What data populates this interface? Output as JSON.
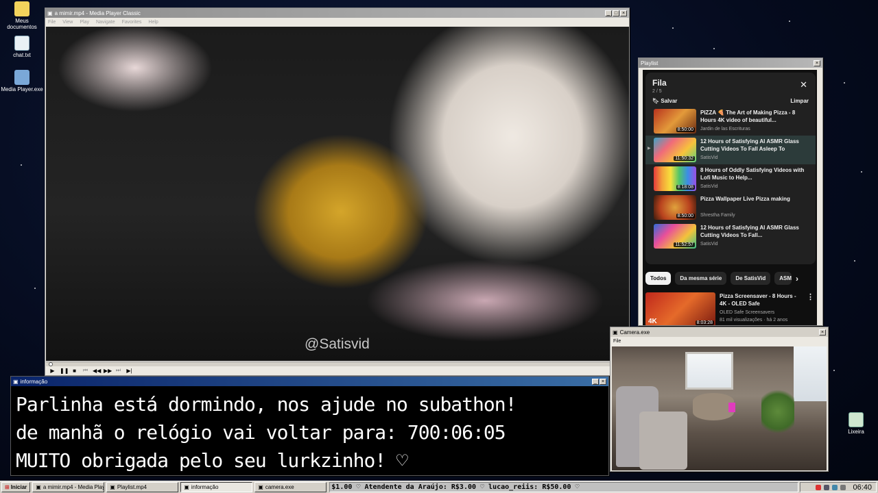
{
  "desktop": {
    "icons": [
      {
        "label": "Meus documentos"
      },
      {
        "label": "chat.txt"
      },
      {
        "label": "Media Player.exe"
      },
      {
        "label": "Lixeira"
      }
    ]
  },
  "player": {
    "title": "a mimir.mp4 - Media Player Classic",
    "menu": [
      "File",
      "View",
      "Play",
      "Navigate",
      "Favorites",
      "Help"
    ],
    "watermark": "@Satisvid"
  },
  "info": {
    "title": "informação",
    "lines": [
      "Parlinha está dormindo, nos ajude no subathon!",
      "de manhã o relógio vai voltar para:  700:06:05",
      "MUITO obrigada pelo seu lurkzinho! ♡"
    ]
  },
  "playlist": {
    "title": "Playlist",
    "queue_title": "Fila",
    "queue_count": "2 / 5",
    "save_label": "Salvar",
    "clear_label": "Limpar",
    "items": [
      {
        "title": "PIZZA 🍕 The Art of Making Pizza - 8 Hours 4K video of beautiful...",
        "channel": "Jardin de las Escrituras",
        "duration": "8:50:00"
      },
      {
        "title": "12 Hours of Satisfying AI ASMR Glass Cutting Videos To Fall Asleep To",
        "channel": "SatisVid",
        "duration": "11:50:32"
      },
      {
        "title": "8 Hours of Oddly Satisfying Videos with Lofi Music to Help...",
        "channel": "SatisVid",
        "duration": "8:18:08"
      },
      {
        "title": "Pizza Wallpaper Live Pizza making",
        "channel": "Shrestha Family",
        "duration": "8:50:00"
      },
      {
        "title": "12 Hours of Satisfying AI ASMR Glass Cutting Videos To Fall...",
        "channel": "SatisVid",
        "duration": "11:52:57"
      }
    ],
    "chips": [
      "Todos",
      "Da mesma série",
      "De SatisVid",
      "ASM"
    ],
    "recommended": {
      "title": "Pizza Screensaver - 8 Hours - 4K - OLED Safe",
      "channel": "OLED Safe Screensavers",
      "stats": "81 mil visualizações · há 2 anos",
      "duration": "8:03:28",
      "badge": "4K"
    }
  },
  "camera": {
    "title": "Camera.exe",
    "menu_file": "File"
  },
  "taskbar": {
    "start_label": "Iniciar",
    "tasks": [
      "a mimir.mp4 - Media Playe...",
      "Playlist.mp4",
      "informação",
      "camera.exe"
    ],
    "ticker": "$1.00  ♡ Atendente da Araújo: R$3.00  ♡ lucao_reiis: R$50.00  ♡",
    "clock": "06:40"
  }
}
